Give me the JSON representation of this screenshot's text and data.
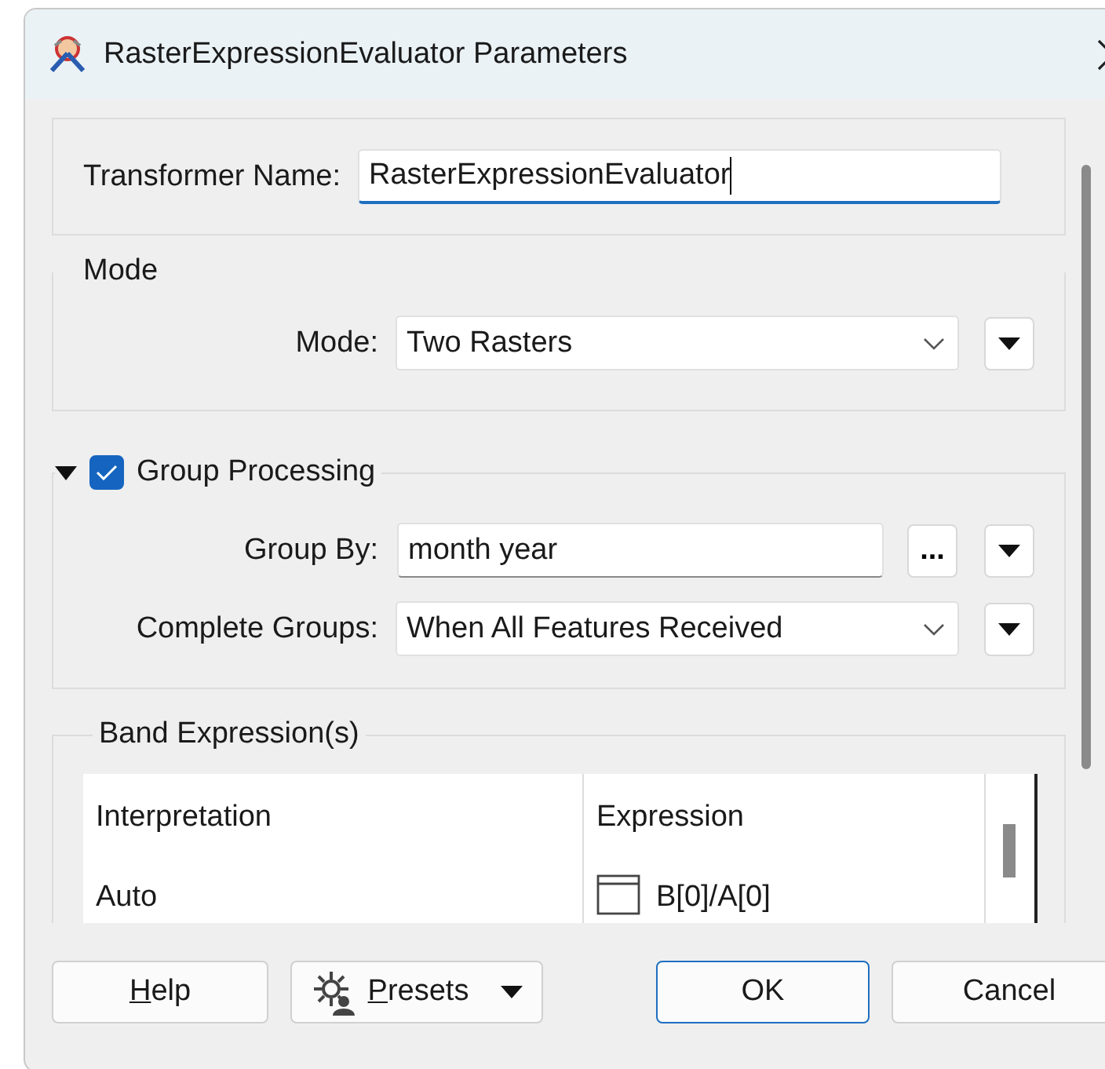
{
  "window": {
    "title": "RasterExpressionEvaluator Parameters"
  },
  "transformer_name": {
    "label": "Transformer Name:",
    "value": "RasterExpressionEvaluator"
  },
  "mode": {
    "title": "Mode",
    "label": "Mode:",
    "value": "Two Rasters"
  },
  "group_processing": {
    "title": "Group Processing",
    "expanded": true,
    "checked": true,
    "group_by": {
      "label": "Group By:",
      "value": "month year",
      "browse": "..."
    },
    "complete_groups": {
      "label": "Complete Groups:",
      "value": "When All Features Received"
    }
  },
  "band_expressions": {
    "title": "Band Expression(s)",
    "columns": [
      "Interpretation",
      "Expression"
    ],
    "rows": [
      {
        "interpretation": "Auto",
        "expression": "B[0]/A[0]"
      }
    ]
  },
  "buttons": [
    {
      "label": "Help",
      "kind": "plain",
      "underline_first": true,
      "default": false
    },
    {
      "label": "Presets",
      "kind": "menu",
      "underline_first": true,
      "default": false
    },
    {
      "label": "OK",
      "kind": "plain",
      "underline_first": false,
      "default": true
    },
    {
      "label": "Cancel",
      "kind": "plain",
      "underline_first": false,
      "default": false
    }
  ]
}
